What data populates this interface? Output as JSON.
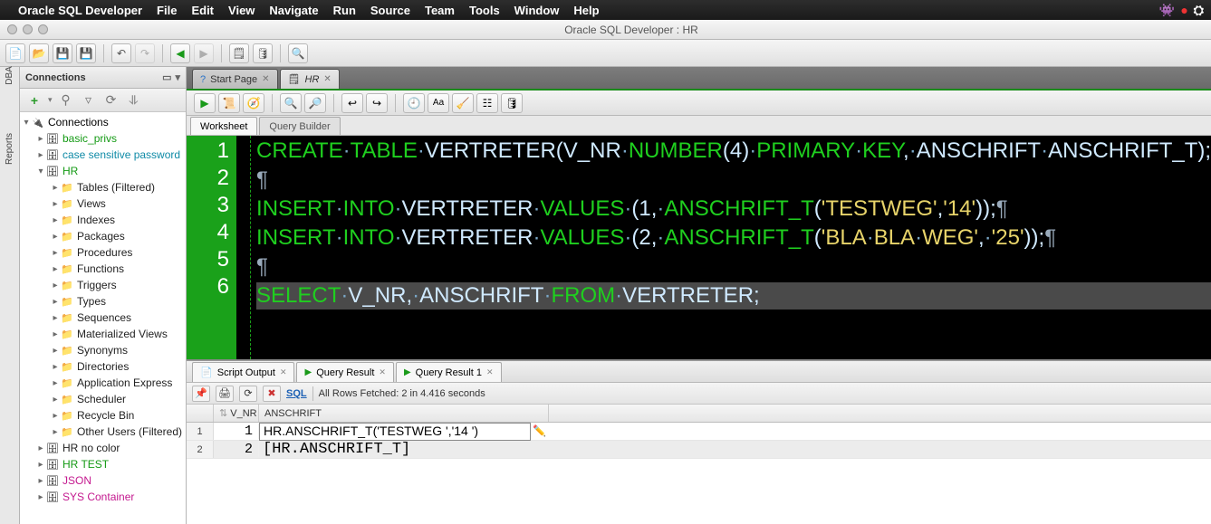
{
  "menubar": {
    "appName": "Oracle SQL Developer",
    "items": [
      "File",
      "Edit",
      "View",
      "Navigate",
      "Run",
      "Source",
      "Team",
      "Tools",
      "Window",
      "Help"
    ]
  },
  "window": {
    "title": "Oracle SQL Developer : HR"
  },
  "leftRail": {
    "labels": [
      "DBA",
      "Reports"
    ]
  },
  "connectionsPanel": {
    "title": "Connections",
    "root": "Connections",
    "items": [
      {
        "label": "basic_privs",
        "cls": "t-green",
        "indent": 1,
        "icon": "db"
      },
      {
        "label": "case sensitive password",
        "cls": "t-cyan",
        "indent": 1,
        "icon": "db"
      },
      {
        "label": "HR",
        "cls": "t-green",
        "indent": 1,
        "icon": "db",
        "expanded": true
      },
      {
        "label": "Tables (Filtered)",
        "cls": "t-black",
        "indent": 2,
        "icon": "folder"
      },
      {
        "label": "Views",
        "cls": "t-black",
        "indent": 2,
        "icon": "folder"
      },
      {
        "label": "Indexes",
        "cls": "t-black",
        "indent": 2,
        "icon": "folder"
      },
      {
        "label": "Packages",
        "cls": "t-black",
        "indent": 2,
        "icon": "folder"
      },
      {
        "label": "Procedures",
        "cls": "t-black",
        "indent": 2,
        "icon": "folder"
      },
      {
        "label": "Functions",
        "cls": "t-black",
        "indent": 2,
        "icon": "folder"
      },
      {
        "label": "Triggers",
        "cls": "t-black",
        "indent": 2,
        "icon": "folder"
      },
      {
        "label": "Types",
        "cls": "t-black",
        "indent": 2,
        "icon": "folder"
      },
      {
        "label": "Sequences",
        "cls": "t-black",
        "indent": 2,
        "icon": "folder"
      },
      {
        "label": "Materialized Views",
        "cls": "t-black",
        "indent": 2,
        "icon": "folder"
      },
      {
        "label": "Synonyms",
        "cls": "t-black",
        "indent": 2,
        "icon": "folder"
      },
      {
        "label": "Directories",
        "cls": "t-black",
        "indent": 2,
        "icon": "folder"
      },
      {
        "label": "Application Express",
        "cls": "t-black",
        "indent": 2,
        "icon": "folder"
      },
      {
        "label": "Scheduler",
        "cls": "t-black",
        "indent": 2,
        "icon": "folder"
      },
      {
        "label": "Recycle Bin",
        "cls": "t-black",
        "indent": 2,
        "icon": "folder"
      },
      {
        "label": "Other Users (Filtered)",
        "cls": "t-black",
        "indent": 2,
        "icon": "folder"
      },
      {
        "label": "HR no color",
        "cls": "t-black",
        "indent": 1,
        "icon": "db"
      },
      {
        "label": "HR TEST",
        "cls": "t-green",
        "indent": 1,
        "icon": "db"
      },
      {
        "label": "JSON",
        "cls": "t-magenta",
        "indent": 1,
        "icon": "db"
      },
      {
        "label": "SYS Container",
        "cls": "t-magenta",
        "indent": 1,
        "icon": "db"
      }
    ]
  },
  "editorTabs": [
    {
      "label": "Start Page",
      "icon": "?",
      "active": false
    },
    {
      "label": "HR",
      "icon": "sql",
      "active": true
    }
  ],
  "worksheetTabs": {
    "worksheet": "Worksheet",
    "queryBuilder": "Query Builder"
  },
  "code": {
    "lines": [
      "1",
      "2",
      "3",
      "4",
      "5",
      "6"
    ]
  },
  "outputTabs": [
    {
      "label": "Script Output"
    },
    {
      "label": "Query Result"
    },
    {
      "label": "Query Result 1"
    }
  ],
  "outputBar": {
    "sql": "SQL",
    "status": "All Rows Fetched: 2 in 4.416 seconds"
  },
  "grid": {
    "columns": [
      "V_NR",
      "ANSCHRIFT"
    ],
    "rows": [
      {
        "n": "1",
        "vnr": "1",
        "anschrift": "HR.ANSCHRIFT_T('TESTWEG    ','14 ')"
      },
      {
        "n": "2",
        "vnr": "2",
        "anschrift": "[HR.ANSCHRIFT_T]"
      }
    ]
  }
}
